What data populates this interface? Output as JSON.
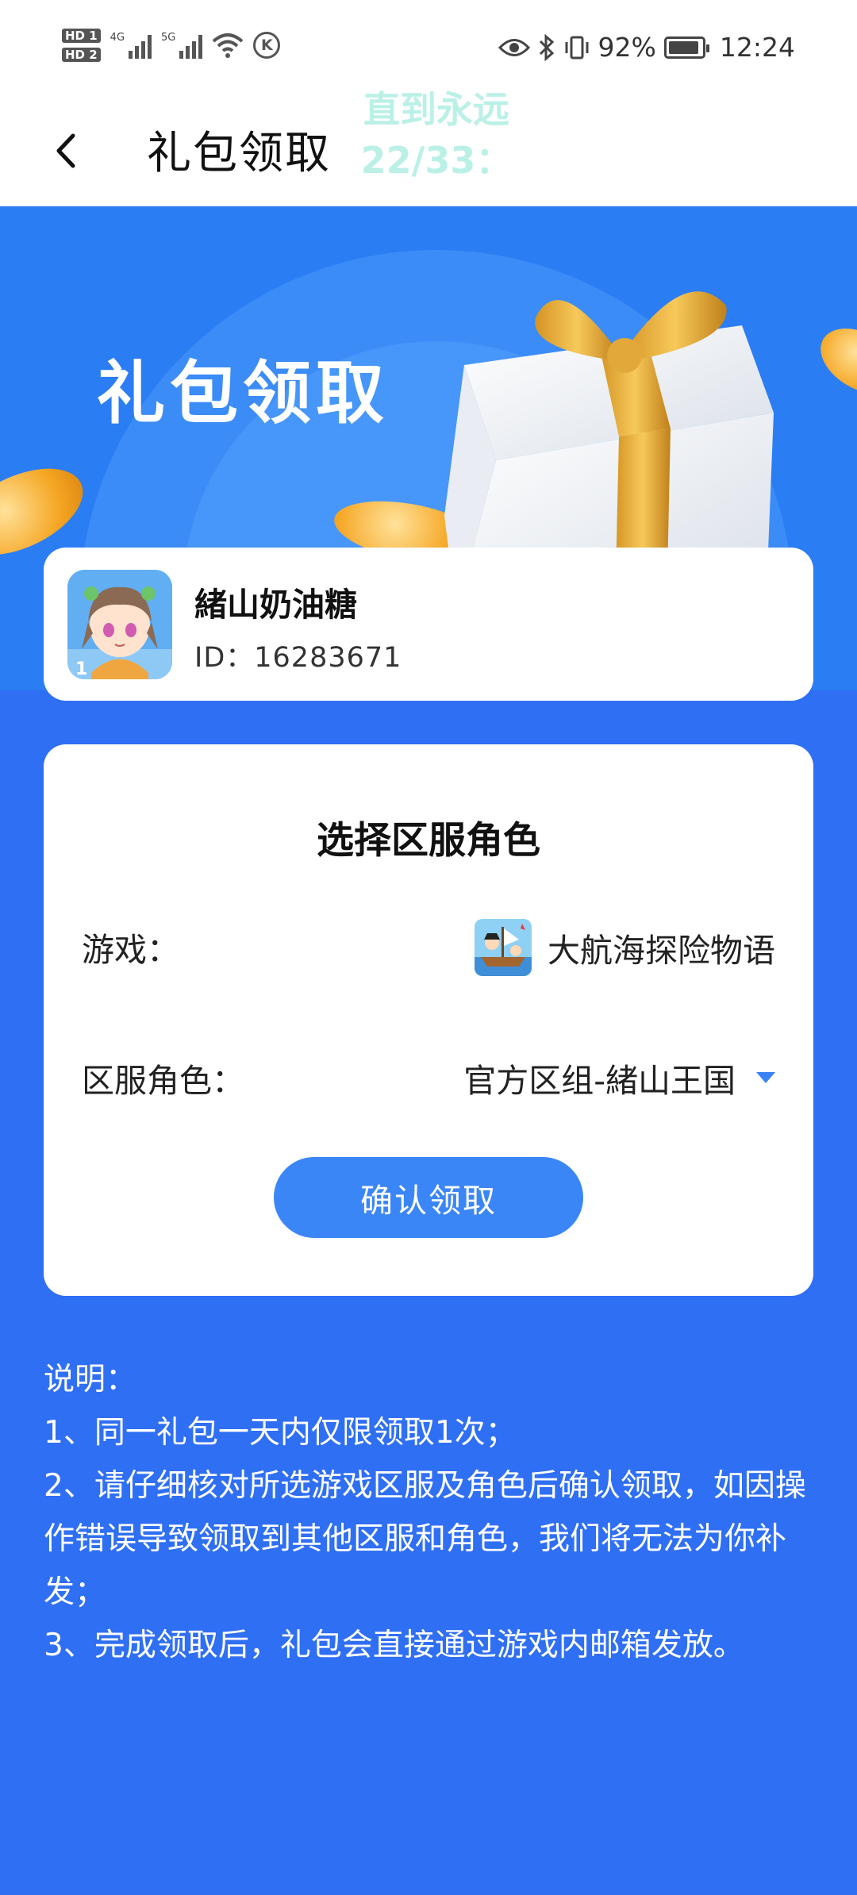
{
  "status_bar": {
    "hd1": "HD 1",
    "hd2": "HD 2",
    "net1": "4G",
    "net2": "5G",
    "battery_text": "92%",
    "time": "12:24",
    "icons": [
      "wifi-icon",
      "k-icon",
      "eye-icon",
      "bluetooth-icon",
      "vibrate-icon",
      "battery-icon"
    ]
  },
  "header": {
    "title": "礼包领取",
    "overlay_line1": "直到永远",
    "overlay_line2": "22/33："
  },
  "banner": {
    "title": "礼包领取"
  },
  "user": {
    "name": "緒山奶油糖",
    "id_text": "ID：16283671"
  },
  "select": {
    "title": "选择区服角色",
    "game_label": "游戏：",
    "game_value": "大航海探险物语",
    "server_label": "区服角色：",
    "server_value": "官方区组-緒山王国",
    "confirm_label": "确认领取"
  },
  "notes": {
    "heading": "说明：",
    "line1": "1、同一礼包一天内仅限领取1次；",
    "line2": "2、请仔细核对所选游戏区服及角色后确认领取，如因操作错误导致领取到其他区服和角色，我们将无法为你补发；",
    "line3": "3、完成领取后，礼包会直接通过游戏内邮箱发放。"
  },
  "colors": {
    "background": "#2f6ff3",
    "accent": "#3b86f6",
    "overlay_text": "#b8f0e6"
  }
}
